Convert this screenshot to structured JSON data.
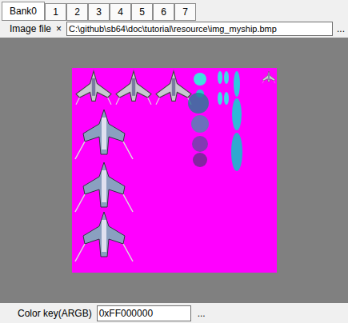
{
  "tabs": [
    {
      "label": "Bank0",
      "selected": true
    },
    {
      "label": "1",
      "selected": false
    },
    {
      "label": "2",
      "selected": false
    },
    {
      "label": "3",
      "selected": false
    },
    {
      "label": "4",
      "selected": false
    },
    {
      "label": "5",
      "selected": false
    },
    {
      "label": "6",
      "selected": false
    },
    {
      "label": "7",
      "selected": false
    }
  ],
  "image_file": {
    "label": "Image file",
    "clear_button": "×",
    "path": "C:\\github\\sb64\\doc\\tutorial\\resource\\img_myship.bmp",
    "browse_button": "..."
  },
  "color_key": {
    "label": "Color key(ARGB)",
    "value": "0xFF000000",
    "browse_button": "..."
  }
}
